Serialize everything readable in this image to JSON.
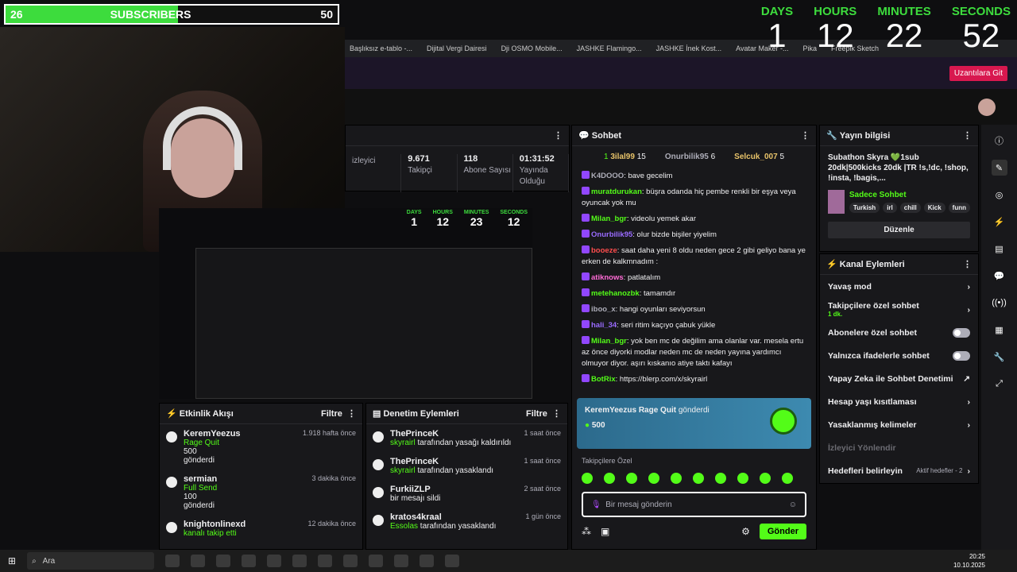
{
  "overlay": {
    "subs_left": "26",
    "subs_label": "SUBSCRIBERS",
    "subs_right": "50",
    "progress": 0.52,
    "timer": [
      {
        "label": "DAYS",
        "value": "1"
      },
      {
        "label": "HOURS",
        "value": "12"
      },
      {
        "label": "MINUTES",
        "value": "22"
      },
      {
        "label": "SECONDS",
        "value": "52"
      }
    ]
  },
  "bookmarks": [
    "Başlıksız e-tablo -...",
    "Dijital Vergi Dairesi",
    "Dji OSMO Mobile...",
    "JASHKE Flamingo...",
    "JASHKE İnek Kost...",
    "Avatar Maker -...",
    "Pika",
    "Freepik Sketch"
  ],
  "ext_button": "Uzantılara Git",
  "stats": [
    {
      "value": "",
      "label": "izleyici"
    },
    {
      "value": "9.671",
      "label": "Takipçi"
    },
    {
      "value": "118",
      "label": "Abone Sayısı"
    },
    {
      "value": "01:31:52",
      "label": "Yayında Olduğu"
    }
  ],
  "preview_timer": [
    {
      "label": "DAYS",
      "value": "1"
    },
    {
      "label": "HOURS",
      "value": "12"
    },
    {
      "label": "MINUTES",
      "value": "23"
    },
    {
      "label": "SECONDS",
      "value": "12"
    }
  ],
  "activity": {
    "title": "Etkinlik Akışı",
    "filter": "Filtre",
    "items": [
      {
        "user": "KeremYeezus",
        "time": "1.918 hafta önce",
        "line1": "Rage Quit",
        "line2": "500",
        "line3": "gönderdi"
      },
      {
        "user": "sermian",
        "time": "3 dakika önce",
        "line1": "Full Send",
        "line2": "100",
        "line3": "gönderdi"
      },
      {
        "user": "knightonlinexd",
        "time": "12 dakika önce",
        "line1": "kanalı takip etti",
        "line2": "",
        "line3": ""
      }
    ]
  },
  "modlog": {
    "title": "Denetim Eylemleri",
    "filter": "Filtre",
    "items": [
      {
        "user": "ThePrinceK",
        "time": "1 saat önce",
        "actor": "skyrairl",
        "action": "tarafından yasağı kaldırıldı"
      },
      {
        "user": "ThePrinceK",
        "time": "1 saat önce",
        "actor": "skyrairl",
        "action": "tarafından yasaklandı"
      },
      {
        "user": "FurkiiZLP",
        "time": "2 saat önce",
        "actor": "",
        "action": "bir mesajı sildi"
      },
      {
        "user": "kratos4kraal",
        "time": "1 gün önce",
        "actor": "Essolas",
        "action": "tarafından yasaklandı"
      }
    ]
  },
  "chat": {
    "title": "Sohbet",
    "pinned": [
      {
        "rank": "1",
        "name": "3ilal99",
        "count": "15"
      },
      {
        "rank": "",
        "name": "Onurbilik95",
        "count": "6"
      },
      {
        "rank": "",
        "name": "Selcuk_007",
        "count": "5"
      }
    ],
    "messages": [
      {
        "user": "K4DOOO",
        "color": "#adadb8",
        "text": "bave gecelim"
      },
      {
        "user": "muratdurukan",
        "color": "#53fc18",
        "text": "büşra odanda hiç pembe renkli bir eşya veya oyuncak yok mu"
      },
      {
        "user": "Milan_bgr",
        "color": "#53fc18",
        "text": "videolu yemek akar"
      },
      {
        "user": "Onurbilik95",
        "color": "#9a6bff",
        "text": "olur bizde bişiler yiyelim"
      },
      {
        "user": "booeze",
        "color": "#ff4d4d",
        "text": "saat daha yeni 8 oldu neden gece 2 gibi geliyo bana ye erken de kalkmnadım :"
      },
      {
        "user": "atiknows",
        "color": "#ff6bd6",
        "text": "patlatalım"
      },
      {
        "user": "metehanozbk",
        "color": "#53fc18",
        "text": "tamamdır"
      },
      {
        "user": "iboo_x",
        "color": "#adadb8",
        "text": "hangi oyunları seviyorsun"
      },
      {
        "user": "hali_34",
        "color": "#9a6bff",
        "text": "seri ritim kaçıyo çabuk yükle"
      },
      {
        "user": "Milan_bgr",
        "color": "#53fc18",
        "text": "yok ben mc de değilim ama olanlar var. mesela ertu az önce diyorki modlar neden mc de neden yayına yardımcı olmuyor diyor. aşırı kıskanıo atiye taktı kafayı"
      },
      {
        "user": "BotRix",
        "color": "#53fc18",
        "text": "https://blerp.com/x/skyrairl"
      }
    ],
    "gift": {
      "user": "KeremYeezus",
      "item": "Rage Quit",
      "verb": "gönderdi",
      "amount": "500"
    },
    "follower_label": "Takipçilere Özel",
    "placeholder": "Bir mesaj gönderin",
    "send": "Gönder"
  },
  "info": {
    "title": "Yayın bilgisi",
    "stream_title": "Subathon Skyra 💚1sub 20dk|500kicks 20dk |TR !s,!dc, !shop, !insta, !bagis,...",
    "category": "Sadece Sohbet",
    "tags": [
      "Turkish",
      "irl",
      "chill",
      "Kick",
      "funn"
    ],
    "edit": "Düzenle"
  },
  "channel": {
    "title": "Kanal Eylemleri",
    "rows": [
      {
        "label": "Yavaş mod",
        "sub": "",
        "kind": "chevron"
      },
      {
        "label": "Takipçilere özel sohbet",
        "sub": "1 dk.",
        "kind": "chevron"
      },
      {
        "label": "Abonelere özel sohbet",
        "sub": "",
        "kind": "toggle"
      },
      {
        "label": "Yalnızca ifadelerle sohbet",
        "sub": "",
        "kind": "toggle"
      },
      {
        "label": "Yapay Zeka ile Sohbet Denetimi",
        "sub": "",
        "kind": "ext"
      },
      {
        "label": "Hesap yaşı kısıtlaması",
        "sub": "",
        "kind": "chevron"
      },
      {
        "label": "Yasaklanmış kelimeler",
        "sub": "",
        "kind": "chevron"
      },
      {
        "label": "İzleyici Yönlendir",
        "sub": "",
        "kind": "none"
      },
      {
        "label": "Hedefleri belirleyin",
        "sub": "Aktif hedefler - 2",
        "kind": "chevron"
      }
    ]
  },
  "taskbar": {
    "search": "Ara",
    "time": "20:25",
    "date": "10.10.2025"
  }
}
